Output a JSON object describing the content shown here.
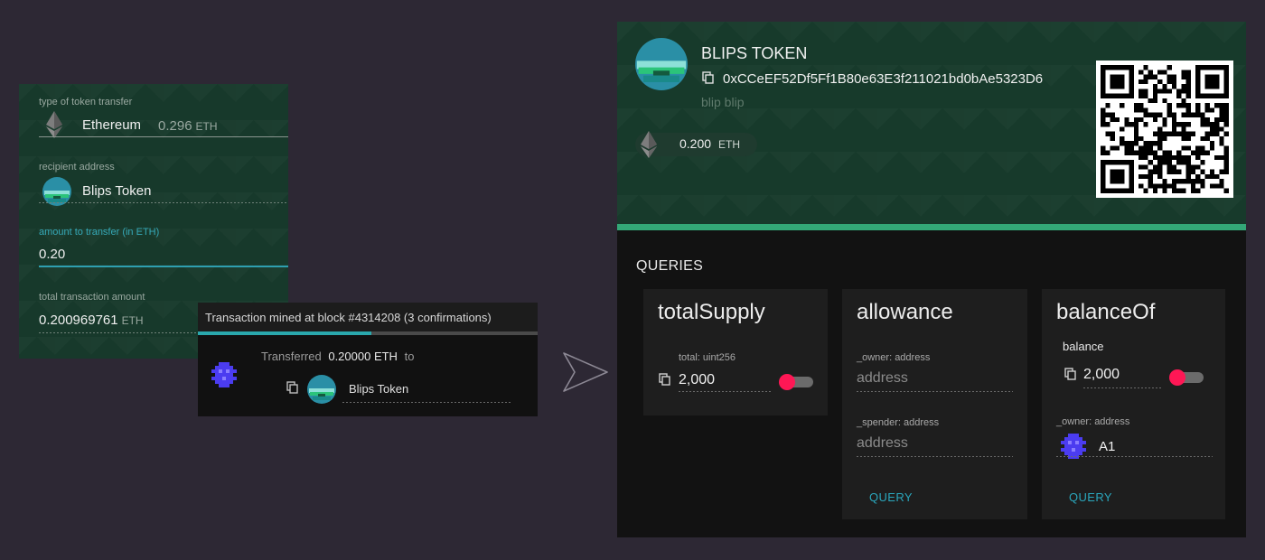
{
  "transfer_form": {
    "type_label": "type of token transfer",
    "type_value": "Ethereum",
    "type_balance": "0.296",
    "type_balance_unit": "ETH",
    "recipient_label": "recipient address",
    "recipient_value": "Blips Token",
    "amount_label": "amount to transfer (in ETH)",
    "amount_value": "0.20",
    "total_label": "total transaction amount",
    "total_value": "0.200969761",
    "total_unit": "ETH"
  },
  "transaction": {
    "title": "Transaction mined at block #4314208 (3 confirmations)",
    "progress_percent": 51,
    "transferred_label": "Transferred",
    "amount": "0.20000 ETH",
    "to_label": "to",
    "recipient": "Blips Token"
  },
  "token": {
    "name": "BLIPS TOKEN",
    "address": "0xCCeEF52Df5Ff1B80e63E3f211021bd0bAe5323D6",
    "description": "blip blip",
    "balance": "0.200",
    "balance_unit": "ETH"
  },
  "queries": {
    "title": "QUERIES",
    "total_supply": {
      "title": "totalSupply",
      "output_label": "total: uint256",
      "output_value": "2,000"
    },
    "allowance": {
      "title": "allowance",
      "owner_label": "_owner: address",
      "owner_placeholder": "address",
      "spender_label": "_spender: address",
      "spender_placeholder": "address",
      "button": "QUERY"
    },
    "balance_of": {
      "title": "balanceOf",
      "output_label": "balance",
      "output_value": "2,000",
      "owner_label": "_owner: address",
      "owner_value": "A1",
      "button": "QUERY"
    }
  },
  "colors": {
    "accent_green": "#33a877",
    "accent_teal": "#2aa7bd",
    "toggle_red": "#ff1755"
  }
}
